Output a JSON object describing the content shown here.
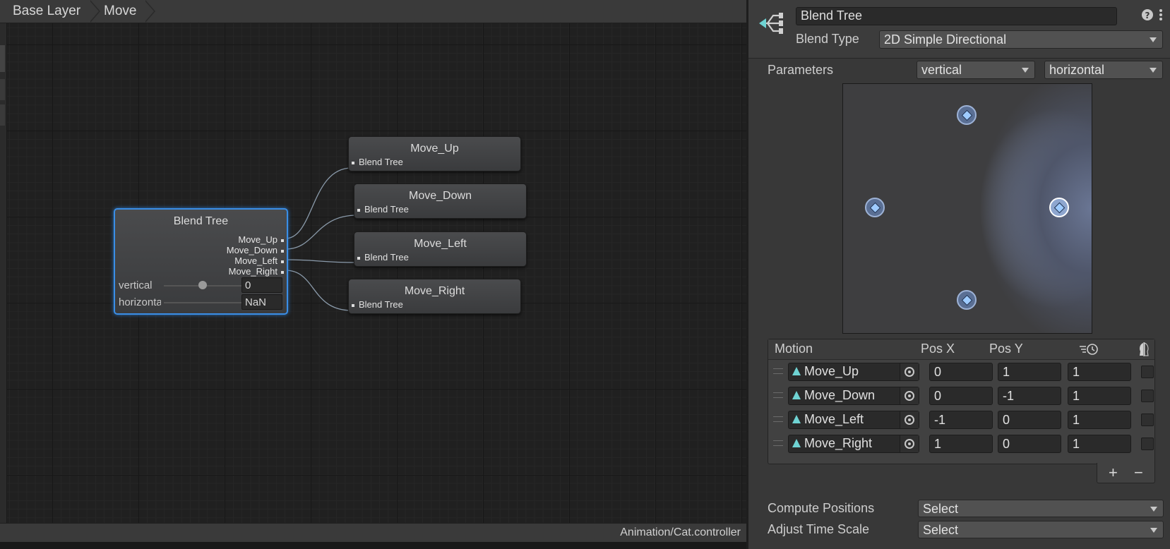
{
  "breadcrumb": {
    "items": [
      "Base Layer",
      "Move"
    ]
  },
  "footer": {
    "path": "Animation/Cat.controller"
  },
  "blend_tree_node": {
    "title": "Blend Tree",
    "outputs": [
      "Move_Up",
      "Move_Down",
      "Move_Left",
      "Move_Right"
    ],
    "params": [
      {
        "label": "vertical",
        "value": "0"
      },
      {
        "label": "horizontal",
        "value": "NaN"
      }
    ]
  },
  "child_nodes": [
    {
      "title": "Move_Up",
      "port": "Blend Tree"
    },
    {
      "title": "Move_Down",
      "port": "Blend Tree"
    },
    {
      "title": "Move_Left",
      "port": "Blend Tree"
    },
    {
      "title": "Move_Right",
      "port": "Blend Tree"
    }
  ],
  "inspector": {
    "name": "Blend Tree",
    "blend_type_label": "Blend Type",
    "blend_type": "2D Simple Directional",
    "parameters_label": "Parameters",
    "param_x": "vertical",
    "param_y": "horizontal",
    "table_headers": {
      "motion": "Motion",
      "pos_x": "Pos X",
      "pos_y": "Pos Y"
    },
    "motions": [
      {
        "name": "Move_Up",
        "pos_x": "0",
        "pos_y": "1",
        "speed": "1"
      },
      {
        "name": "Move_Down",
        "pos_x": "0",
        "pos_y": "-1",
        "speed": "1"
      },
      {
        "name": "Move_Left",
        "pos_x": "-1",
        "pos_y": "0",
        "speed": "1"
      },
      {
        "name": "Move_Right",
        "pos_x": "1",
        "pos_y": "0",
        "speed": "1"
      }
    ],
    "add_symbol": "+",
    "remove_symbol": "−",
    "compute_positions_label": "Compute Positions",
    "compute_positions_value": "Select",
    "adjust_time_scale_label": "Adjust Time Scale",
    "adjust_time_scale_value": "Select",
    "colors": {
      "selection": "#3a8ee6",
      "point": "#9ecbff",
      "anim_icon": "#6fd3d3"
    }
  }
}
